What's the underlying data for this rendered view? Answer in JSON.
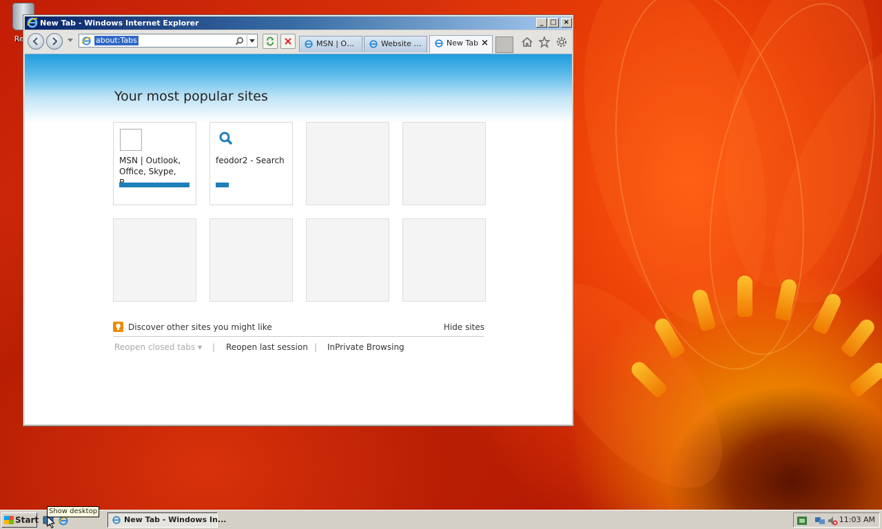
{
  "desktop": {
    "recycle_bin_label": "Recy"
  },
  "window": {
    "title": "New Tab - Windows Internet Explorer",
    "minimize_glyph": "_",
    "maximize_glyph": "□",
    "close_glyph": "×",
    "address_bar": {
      "url": "about:Tabs"
    },
    "tabs": [
      {
        "label": "MSN | Out...",
        "active": false
      },
      {
        "label": "Website r...",
        "active": false
      },
      {
        "label": "New Tab",
        "active": true,
        "close_glyph": "×"
      }
    ]
  },
  "page": {
    "heading": "Your most popular sites",
    "tiles": [
      {
        "name": "MSN | Outlook, Office, Skype, B...",
        "bar_fraction": 1.0
      },
      {
        "name": "feodor2 - Search",
        "bar_fraction": 0.19
      }
    ],
    "discover_text": "Discover other sites you might like",
    "hide_sites": "Hide sites",
    "links": {
      "reopen_closed_tabs": "Reopen closed tabs ▾",
      "separator": "|",
      "reopen_last_session": "Reopen last session",
      "inprivate": "InPrivate Browsing"
    }
  },
  "taskbar": {
    "start_label": "Start",
    "task_title": "New Tab - Windows In...",
    "tooltip": "Show desktop",
    "clock": "11:03 AM"
  },
  "colors": {
    "accent_blue": "#1f7fb8",
    "discover_orange": "#f08a00"
  }
}
